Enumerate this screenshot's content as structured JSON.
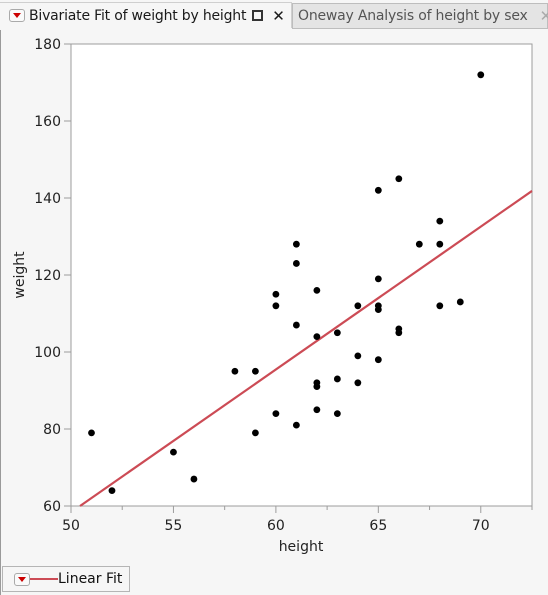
{
  "tabs": [
    {
      "label": "Bivariate Fit of weight by height",
      "active": true,
      "icons": [
        "red-triangle-menu-icon",
        "maximize-icon",
        "close-icon"
      ]
    },
    {
      "label": "Oneway Analysis of height by sex",
      "active": false,
      "icons": [
        "close-icon"
      ]
    }
  ],
  "icons": {
    "close": "✕"
  },
  "legend": {
    "label": "Linear Fit",
    "color": "#cc4b55"
  },
  "colors": {
    "fit_line": "#cc4b55",
    "points": "#000000",
    "menu_triangle": "#cc0000"
  },
  "chart_data": {
    "type": "scatter",
    "title": "Bivariate Fit of weight by height",
    "xlabel": "height",
    "ylabel": "weight",
    "xlim": [
      50,
      72.5
    ],
    "ylim": [
      60,
      180
    ],
    "xticks": [
      50,
      55,
      60,
      65,
      70
    ],
    "yticks": [
      60,
      80,
      100,
      120,
      140,
      160,
      180
    ],
    "grid": false,
    "legend": "bottom-left",
    "points": [
      [
        51,
        79
      ],
      [
        52,
        64
      ],
      [
        55,
        74
      ],
      [
        56,
        67
      ],
      [
        58,
        95
      ],
      [
        59,
        95
      ],
      [
        59,
        79
      ],
      [
        60,
        115
      ],
      [
        60,
        112
      ],
      [
        60,
        84
      ],
      [
        61,
        128
      ],
      [
        61,
        123
      ],
      [
        61,
        107
      ],
      [
        61,
        81
      ],
      [
        62,
        116
      ],
      [
        62,
        104
      ],
      [
        62,
        92
      ],
      [
        62,
        91
      ],
      [
        62,
        85
      ],
      [
        63,
        105
      ],
      [
        63,
        93
      ],
      [
        63,
        84
      ],
      [
        64,
        112
      ],
      [
        64,
        99
      ],
      [
        64,
        92
      ],
      [
        65,
        142
      ],
      [
        65,
        119
      ],
      [
        65,
        112
      ],
      [
        65,
        111
      ],
      [
        65,
        98
      ],
      [
        66,
        145
      ],
      [
        66,
        106
      ],
      [
        66,
        105
      ],
      [
        67,
        128
      ],
      [
        68,
        134
      ],
      [
        68,
        128
      ],
      [
        68,
        112
      ],
      [
        69,
        113
      ],
      [
        70,
        172
      ]
    ],
    "fit": {
      "name": "Linear Fit",
      "intercept": -127.14,
      "slope": 3.71
    }
  }
}
